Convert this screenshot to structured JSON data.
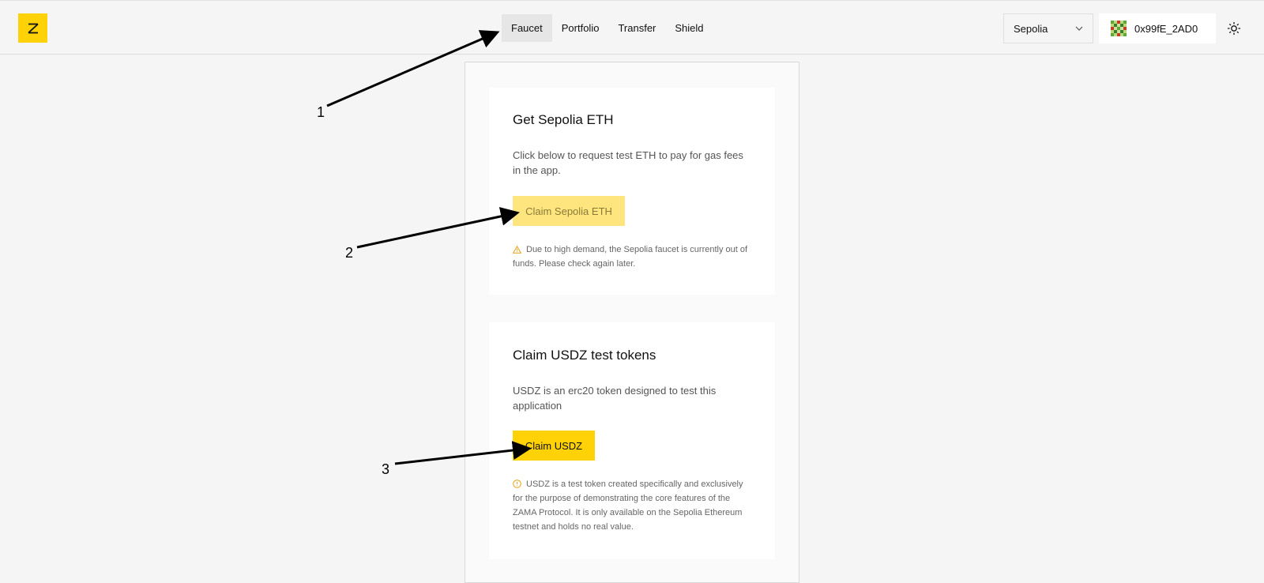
{
  "nav": {
    "items": [
      {
        "label": "Faucet",
        "active": true
      },
      {
        "label": "Portfolio",
        "active": false
      },
      {
        "label": "Transfer",
        "active": false
      },
      {
        "label": "Shield",
        "active": false
      }
    ]
  },
  "network": {
    "selected": "Sepolia"
  },
  "account": {
    "address": "0x99fE_2AD0"
  },
  "cards": {
    "eth": {
      "title": "Get Sepolia ETH",
      "description": "Click below to request test ETH to pay for gas fees in the app.",
      "button": "Claim Sepolia ETH",
      "note": "Due to high demand, the Sepolia faucet is currently out of funds. Please check again later."
    },
    "usdz": {
      "title": "Claim USDZ test tokens",
      "description": "USDZ is an erc20 token designed to test this application",
      "button": "Claim USDZ",
      "note": "USDZ is a test token created specifically and exclusively for the purpose of demonstrating the core features of the ZAMA Protocol. It is only available on the Sepolia Ethereum testnet and holds no real value."
    }
  },
  "annotations": [
    "1",
    "2",
    "3"
  ],
  "colors": {
    "brand": "#ffd208",
    "warning": "#e8a317"
  }
}
